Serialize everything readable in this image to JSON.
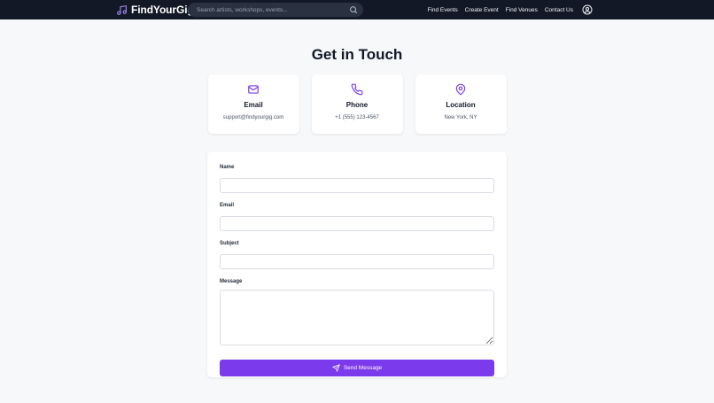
{
  "header": {
    "brand": "FindYourGig",
    "search_placeholder": "Search artists, workshops, events...",
    "nav": [
      {
        "label": "Find Events"
      },
      {
        "label": "Create Event"
      },
      {
        "label": "Find Venues"
      },
      {
        "label": "Contact Us"
      }
    ]
  },
  "page": {
    "title": "Get in Touch"
  },
  "contact_cards": [
    {
      "icon": "mail-icon",
      "title": "Email",
      "value": "support@findyourgig.com"
    },
    {
      "icon": "phone-icon",
      "title": "Phone",
      "value": "+1 (555) 123-4567"
    },
    {
      "icon": "map-pin-icon",
      "title": "Location",
      "value": "New York, NY"
    }
  ],
  "form": {
    "name_label": "Name",
    "email_label": "Email",
    "subject_label": "Subject",
    "message_label": "Message",
    "submit_label": "Send Message"
  },
  "colors": {
    "accent": "#7c3aed",
    "header_bg": "#121826",
    "page_bg": "#f7f8fa"
  }
}
